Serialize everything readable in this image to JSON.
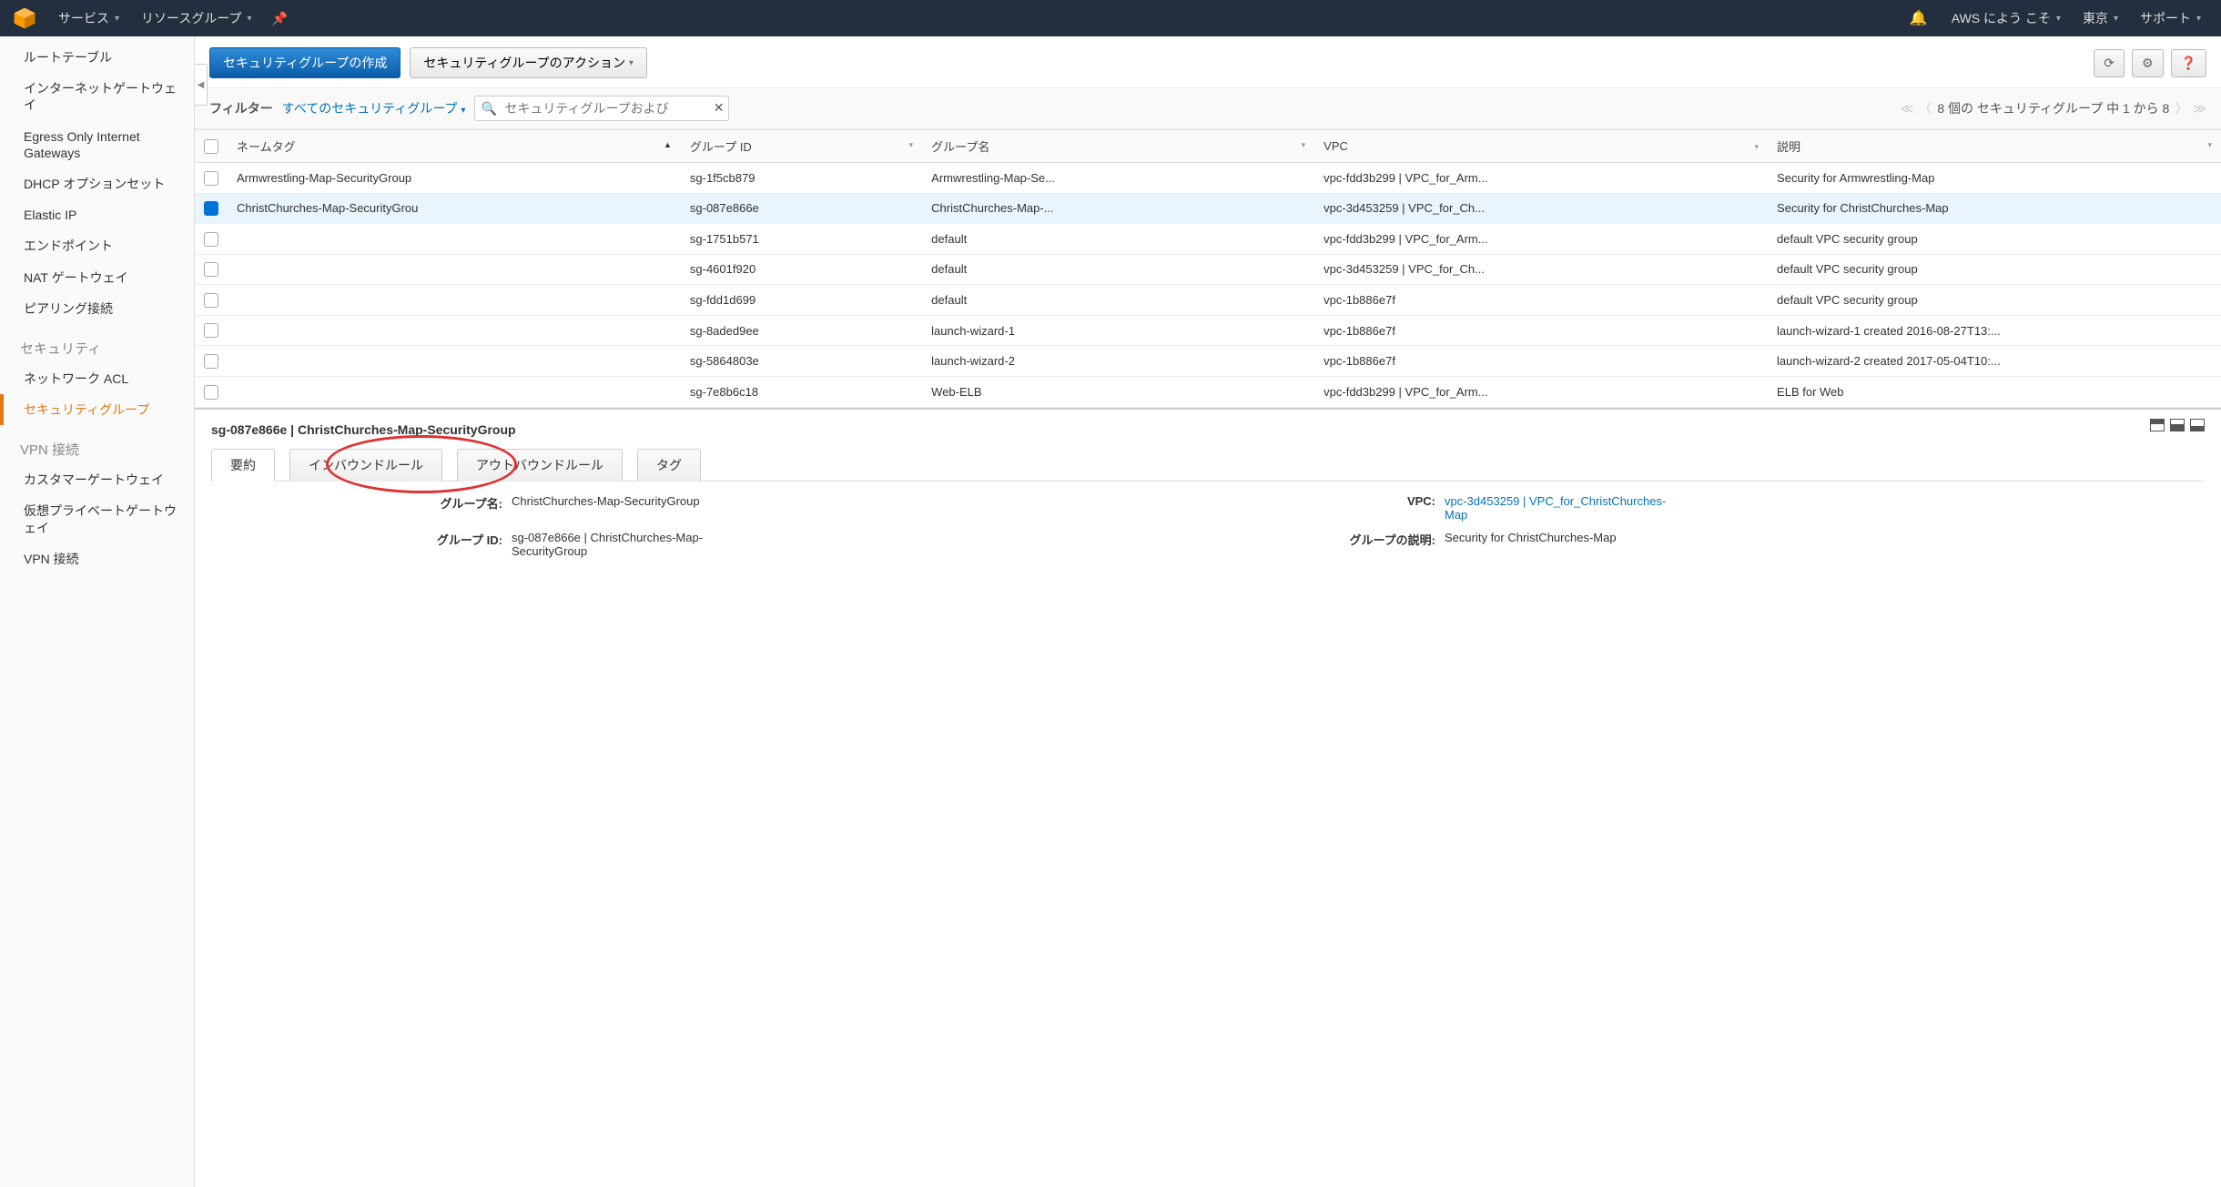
{
  "topnav": {
    "services": "サービス",
    "resource_groups": "リソースグループ",
    "welcome": "AWS によう こそ",
    "region": "東京",
    "support": "サポート"
  },
  "sidebar": {
    "items_top": [
      "ルートテーブル",
      "インターネットゲートウェイ",
      "Egress Only Internet Gateways",
      "DHCP オプションセット",
      "Elastic IP",
      "エンドポイント",
      "NAT ゲートウェイ",
      "ピアリング接続"
    ],
    "heading_sec": "セキュリティ",
    "item_nacl": "ネットワーク ACL",
    "item_sg": "セキュリティグループ",
    "heading_vpn": "VPN 接続",
    "item_cgw": "カスタマーゲートウェイ",
    "item_vpg": "仮想プライベートゲートウェイ",
    "item_vpn": "VPN 接続"
  },
  "toolbar": {
    "create": "セキュリティグループの作成",
    "actions": "セキュリティグループのアクション"
  },
  "filter": {
    "label": "フィルター",
    "dropdown": "すべてのセキュリティグループ",
    "placeholder": " セキュリティグループおよび",
    "pager": "8 個の セキュリティグループ 中 1 から 8"
  },
  "columns": {
    "name_tag": "ネームタグ",
    "group_id": "グループ ID",
    "group_name": "グループ名",
    "vpc": "VPC",
    "description": "説明"
  },
  "rows": [
    {
      "sel": false,
      "name": "Armwrestling-Map-SecurityGroup",
      "gid": "sg-1f5cb879",
      "gname": "Armwrestling-Map-Se...",
      "vpc": "vpc-fdd3b299 | VPC_for_Arm...",
      "desc": "Security for Armwrestling-Map"
    },
    {
      "sel": true,
      "name": "ChristChurches-Map-SecurityGrou",
      "gid": "sg-087e866e",
      "gname": "ChristChurches-Map-...",
      "vpc": "vpc-3d453259 | VPC_for_Ch...",
      "desc": "Security for ChristChurches-Map"
    },
    {
      "sel": false,
      "name": "",
      "gid": "sg-1751b571",
      "gname": "default",
      "vpc": "vpc-fdd3b299 | VPC_for_Arm...",
      "desc": "default VPC security group"
    },
    {
      "sel": false,
      "name": "",
      "gid": "sg-4601f920",
      "gname": "default",
      "vpc": "vpc-3d453259 | VPC_for_Ch...",
      "desc": "default VPC security group"
    },
    {
      "sel": false,
      "name": "",
      "gid": "sg-fdd1d699",
      "gname": "default",
      "vpc": "vpc-1b886e7f",
      "desc": "default VPC security group"
    },
    {
      "sel": false,
      "name": "",
      "gid": "sg-8aded9ee",
      "gname": "launch-wizard-1",
      "vpc": "vpc-1b886e7f",
      "desc": "launch-wizard-1 created 2016-08-27T13:..."
    },
    {
      "sel": false,
      "name": "",
      "gid": "sg-5864803e",
      "gname": "launch-wizard-2",
      "vpc": "vpc-1b886e7f",
      "desc": "launch-wizard-2 created 2017-05-04T10:..."
    },
    {
      "sel": false,
      "name": "",
      "gid": "sg-7e8b6c18",
      "gname": "Web-ELB",
      "vpc": "vpc-fdd3b299 | VPC_for_Arm...",
      "desc": "ELB for Web"
    }
  ],
  "detail": {
    "title": "sg-087e866e | ChristChurches-Map-SecurityGroup",
    "tabs": {
      "summary": "要約",
      "inbound": "インバウンドルール",
      "outbound": "アウトバウンドルール",
      "tags": "タグ"
    },
    "labels": {
      "group_name": "グループ名:",
      "group_id": "グループ ID:",
      "vpc": "VPC:",
      "description": "グループの説明:"
    },
    "values": {
      "group_name": "ChristChurches-Map-SecurityGroup",
      "group_id": "sg-087e866e | ChristChurches-Map-SecurityGroup",
      "vpc": "vpc-3d453259 | VPC_for_ChristChurches-Map",
      "description": "Security for ChristChurches-Map"
    }
  }
}
